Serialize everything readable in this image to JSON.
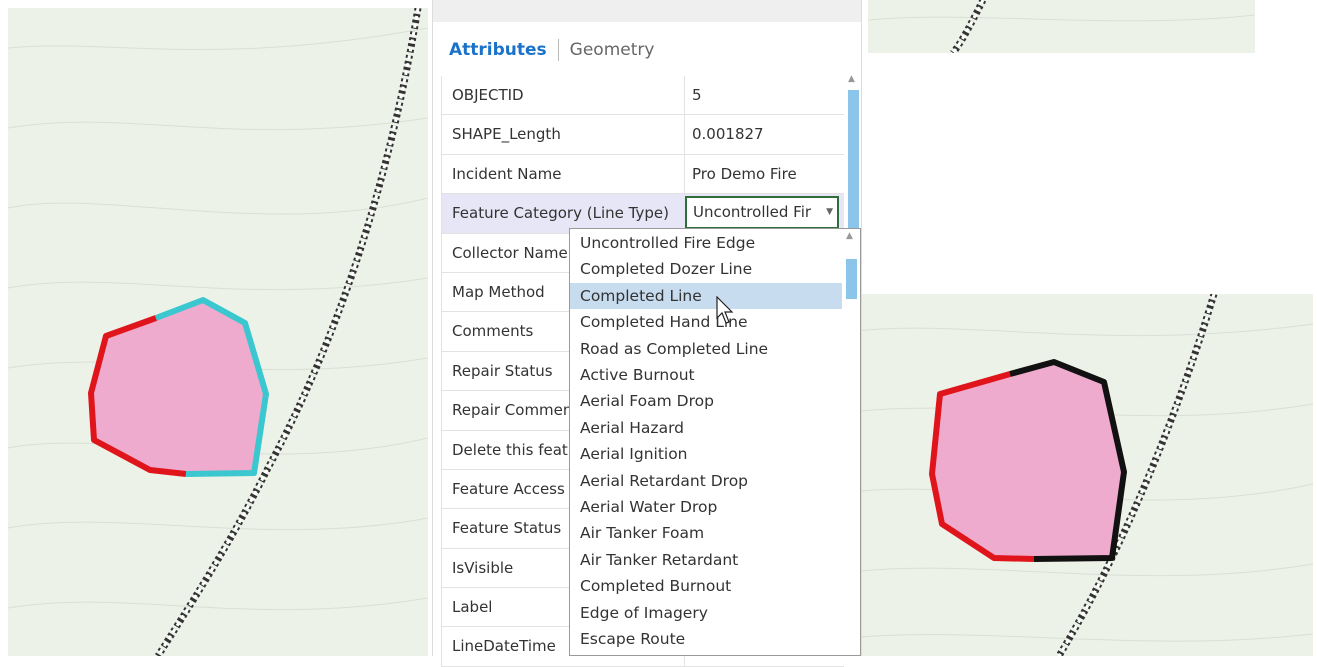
{
  "tabs": {
    "attributes": "Attributes",
    "geometry": "Geometry"
  },
  "fields": [
    {
      "name": "OBJECTID",
      "value": "5"
    },
    {
      "name": "SHAPE_Length",
      "value": "0.001827"
    },
    {
      "name": "Incident Name",
      "value": "Pro Demo Fire"
    },
    {
      "name": "Feature Category (Line Type)",
      "value": "Uncontrolled Fir"
    },
    {
      "name": "Collector Name",
      "value": ""
    },
    {
      "name": "Map Method",
      "value": ""
    },
    {
      "name": "Comments",
      "value": ""
    },
    {
      "name": "Repair Status",
      "value": ""
    },
    {
      "name": "Repair Comments",
      "value": ""
    },
    {
      "name": "Delete this feature",
      "value": ""
    },
    {
      "name": "Feature Access",
      "value": ""
    },
    {
      "name": "Feature Status",
      "value": ""
    },
    {
      "name": "IsVisible",
      "value": ""
    },
    {
      "name": "Label",
      "value": ""
    },
    {
      "name": "LineDateTime",
      "value": ""
    }
  ],
  "dropdown": {
    "hovered_index": 2,
    "options": [
      "Uncontrolled Fire Edge",
      "Completed Dozer Line",
      "Completed Line",
      "Completed Hand Line",
      "Road as Completed Line",
      "Active Burnout",
      "Aerial Foam Drop",
      "Aerial Hazard",
      "Aerial Ignition",
      "Aerial Retardant Drop",
      "Aerial Water Drop",
      "Air Tanker Foam",
      "Air Tanker Retardant",
      "Completed Burnout",
      "Edge of Imagery",
      "Escape Route"
    ]
  },
  "colors": {
    "map_background": "#edf2e8",
    "fire_polygon_fill": "#efabce",
    "uncontrolled_edge": "#e0151c",
    "selected_edge": "#3ac7cf",
    "completed_line": "#111111",
    "accent_tab": "#1a73c8",
    "dropdown_hover": "#c7dcef"
  }
}
